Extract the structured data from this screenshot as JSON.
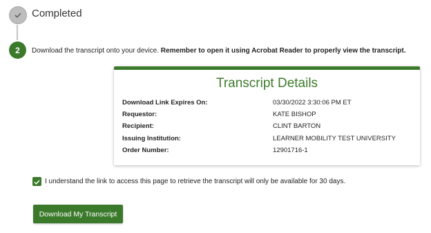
{
  "steps": {
    "completed": {
      "title": "Completed",
      "icon": "checkmark-icon"
    },
    "download": {
      "number": "2",
      "instruction": "Download the transcript onto your device.",
      "instruction_bold": "Remember to open it using Acrobat Reader to properly view the transcript."
    }
  },
  "transcript_details": {
    "title": "Transcript Details",
    "rows": [
      {
        "label": "Download Link Expires On:",
        "value": "03/30/2022 3:30:06 PM ET"
      },
      {
        "label": "Requestor:",
        "value": "KATE BISHOP"
      },
      {
        "label": "Recipient:",
        "value": "CLINT BARTON"
      },
      {
        "label": "Issuing Institution:",
        "value": "LEARNER MOBILITY TEST UNIVERSITY"
      },
      {
        "label": "Order Number:",
        "value": "12901716-1"
      }
    ]
  },
  "acknowledgement": {
    "checked": true,
    "label": "I understand the link to access this page to retrieve the transcript will only be available for 30 days."
  },
  "download_button": {
    "label": "Download My Transcript"
  },
  "colors": {
    "accent_green": "#3c7a2b",
    "completed_gray": "#bdbdbd"
  }
}
